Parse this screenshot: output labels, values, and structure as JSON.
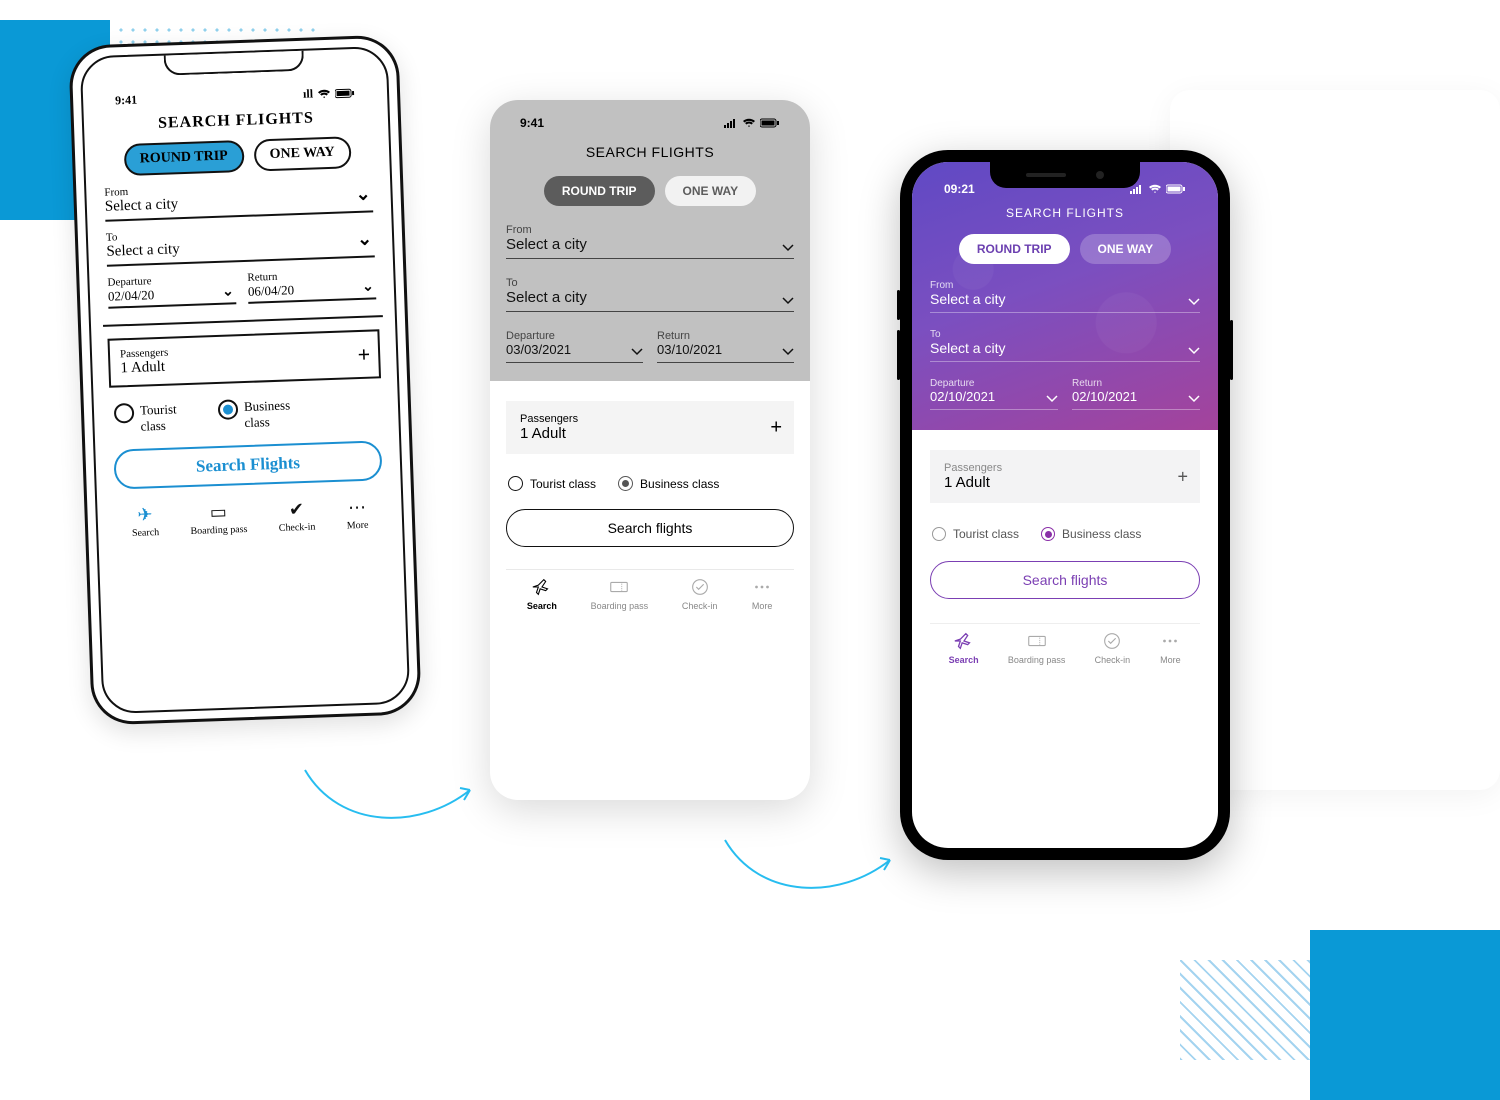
{
  "statusbar": {
    "time_a": "9:41",
    "time_b": "9:41",
    "time_c": "09:21"
  },
  "header": {
    "title": "SEARCH FLIGHTS"
  },
  "toggle": {
    "round_trip": "ROUND TRIP",
    "one_way": "ONE WAY"
  },
  "fields": {
    "from_label": "From",
    "to_label": "To",
    "city_placeholder": "Select a city",
    "departure_label": "Departure",
    "return_label": "Return"
  },
  "dates": {
    "sketch_dep": "02/04/20",
    "sketch_ret": "06/04/20",
    "wire_dep": "03/03/2021",
    "wire_ret": "03/10/2021",
    "hifi_dep": "02/10/2021",
    "hifi_ret": "02/10/2021"
  },
  "passengers": {
    "label": "Passengers",
    "value": "1 Adult"
  },
  "class": {
    "tourist": "Tourist class",
    "business": "Business class"
  },
  "cta": {
    "search_sketch": "Search Flights",
    "search": "Search flights"
  },
  "nav": {
    "search": "Search",
    "boarding": "Boarding pass",
    "checkin": "Check-in",
    "more": "More"
  }
}
